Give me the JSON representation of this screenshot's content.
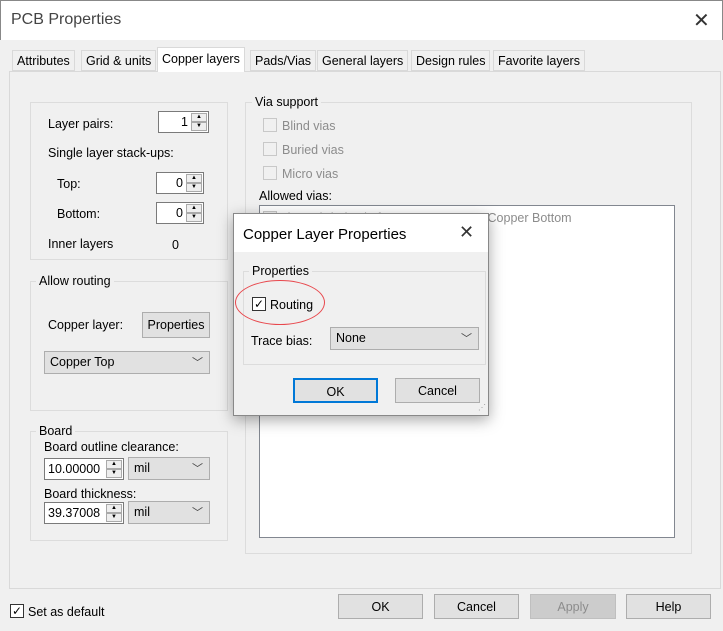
{
  "window": {
    "title": "PCB Properties",
    "close": "✕"
  },
  "tabs": [
    {
      "label": "Attributes"
    },
    {
      "label": "Grid & units"
    },
    {
      "label": "Copper layers"
    },
    {
      "label": "Pads/Vias"
    },
    {
      "label": "General layers"
    },
    {
      "label": "Design rules"
    },
    {
      "label": "Favorite layers"
    }
  ],
  "layers": {
    "pairs_label": "Layer pairs:",
    "pairs_value": "1",
    "single_label": "Single layer stack-ups:",
    "top_label": "Top:",
    "top_value": "0",
    "bottom_label": "Bottom:",
    "bottom_value": "0",
    "inner_label": "Inner layers",
    "inner_value": "0"
  },
  "routing": {
    "group": "Allow routing",
    "copper_label": "Copper layer:",
    "properties_button": "Properties",
    "layer_value": "Copper Top"
  },
  "board": {
    "group": "Board",
    "clearance_label": "Board outline clearance:",
    "clearance_value": "10.00000",
    "clearance_unit": "mil",
    "thickness_label": "Board thickness:",
    "thickness_value": "39.37008",
    "thickness_unit": "mil"
  },
  "via": {
    "group": "Via support",
    "blind": "Blind vias",
    "buried": "Buried vias",
    "micro": "Micro vias",
    "allowed_label": "Allowed vias:",
    "allowed_items": [
      "Through-hole via from Copper Top to Copper Bottom"
    ]
  },
  "footer": {
    "set_default": "Set as default",
    "set_default_checked": true,
    "ok": "OK",
    "cancel": "Cancel",
    "apply": "Apply",
    "help": "Help"
  },
  "dialog": {
    "title": "Copper Layer Properties",
    "close": "✕",
    "group": "Properties",
    "routing_label": "Routing",
    "routing_checked": true,
    "trace_bias_label": "Trace bias:",
    "trace_bias_value": "None",
    "ok": "OK",
    "cancel": "Cancel",
    "highlight_color": "#e8474c"
  }
}
